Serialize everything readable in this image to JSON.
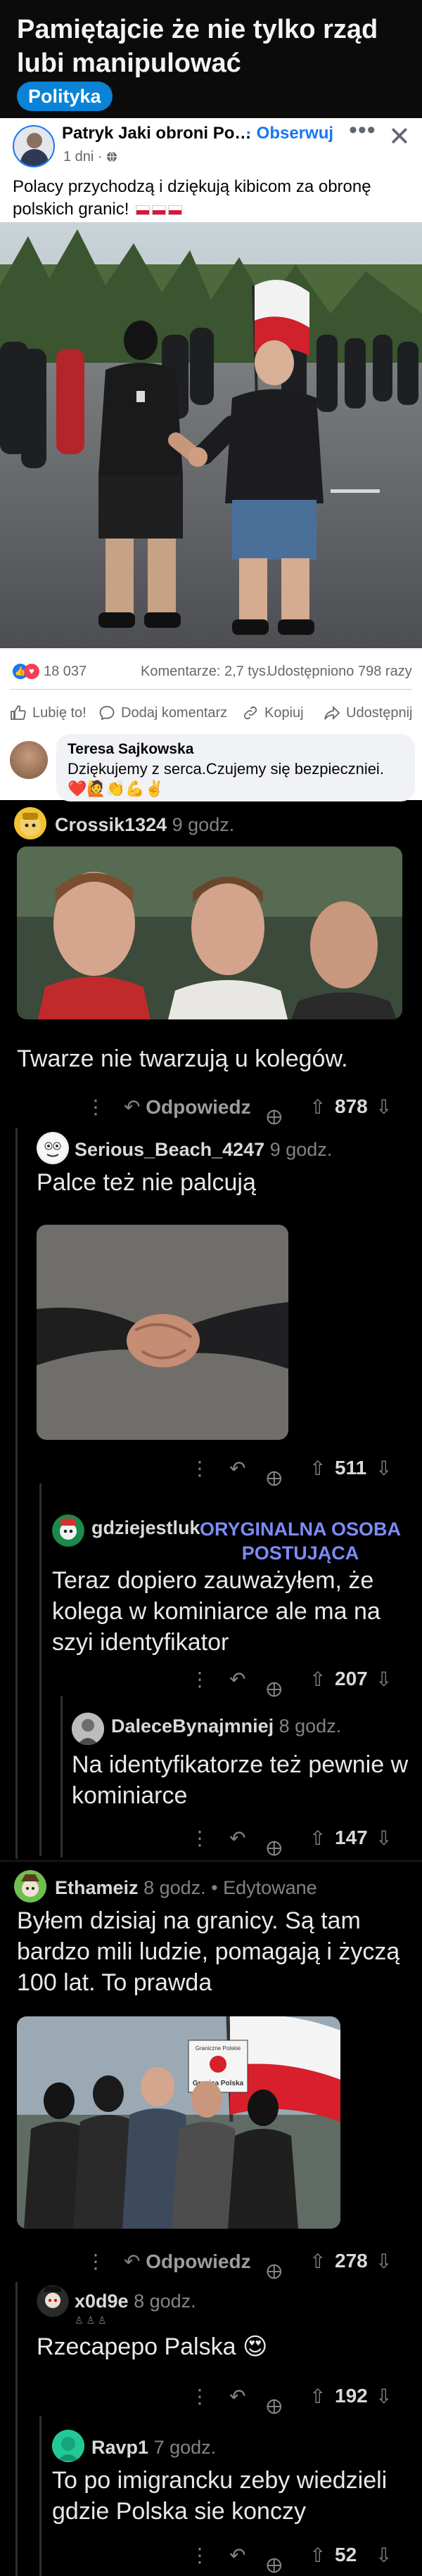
{
  "post": {
    "title": "Pamiętajcie że nie tylko rząd lubi manipulować",
    "flair": "Polityka"
  },
  "fb": {
    "author": "Patryk Jaki obroni Polsk",
    "follow": "· Obserwuj",
    "menu": "•••",
    "close": "✕",
    "meta": "1 dni · ",
    "text": "Polacy przychodzą i dziękują kibicom za obronę polskich granic!",
    "reactions": "18 037",
    "comments": "Komentarze: 2,7 tys.",
    "shares": "Udostępniono 798 razy",
    "actions": {
      "like": "Lubię to!",
      "comment": "Dodaj komentarz",
      "copy": "Kopiuj",
      "share": "Udostępnij"
    },
    "top_comment": {
      "name": "Teresa Sajkowska",
      "text": "Dziękujemy z serca.Czujemy się bezpieczniei."
    }
  },
  "comments": [
    {
      "user": "Crossik1324",
      "time": "9 godz.",
      "text": "Twarze nie twarzują u kolegów.",
      "reply": "Odpowiedz",
      "score": "878"
    },
    {
      "user": "Serious_Beach_4247",
      "time": "9 godz.",
      "text": "Palce też nie palcują",
      "score": "511"
    },
    {
      "user": "gdziejestluk",
      "badge": "ORYGINALNA OSOBA POSTUJĄCA",
      "text": "Teraz dopiero zauważyłem, że kolega w kominiarce ale ma na szyi identyfikator",
      "score": "207"
    },
    {
      "user": "DaleceBynajmniej",
      "time": "8 godz.",
      "text": "Na identyfikatorze też pewnie w kominiarce",
      "score": "147"
    },
    {
      "user": "Ethameiz",
      "time": "8 godz. • Edytowane",
      "text": "Byłem dzisiaj na granicy. Są tam bardzo mili ludzie, pomagają i życzą 100 lat. To prawda",
      "reply": "Odpowiedz",
      "score": "278",
      "sign_line1": "Graniczne Polskie",
      "sign_line2": "Granica Polska"
    },
    {
      "user": "x0d9e",
      "time": "8 godz.",
      "text": "Rzecapepo Palska",
      "score": "192"
    },
    {
      "user": "Ravp1",
      "time": "7 godz.",
      "text": "To po imigrancku zeby wiedzieli gdzie Polska sie konczy",
      "score": "52"
    }
  ],
  "colors": {
    "background": "#000000",
    "fb_blue": "#1877f2",
    "flair": "#0a83d6",
    "op_badge": "#7b8cf7"
  }
}
